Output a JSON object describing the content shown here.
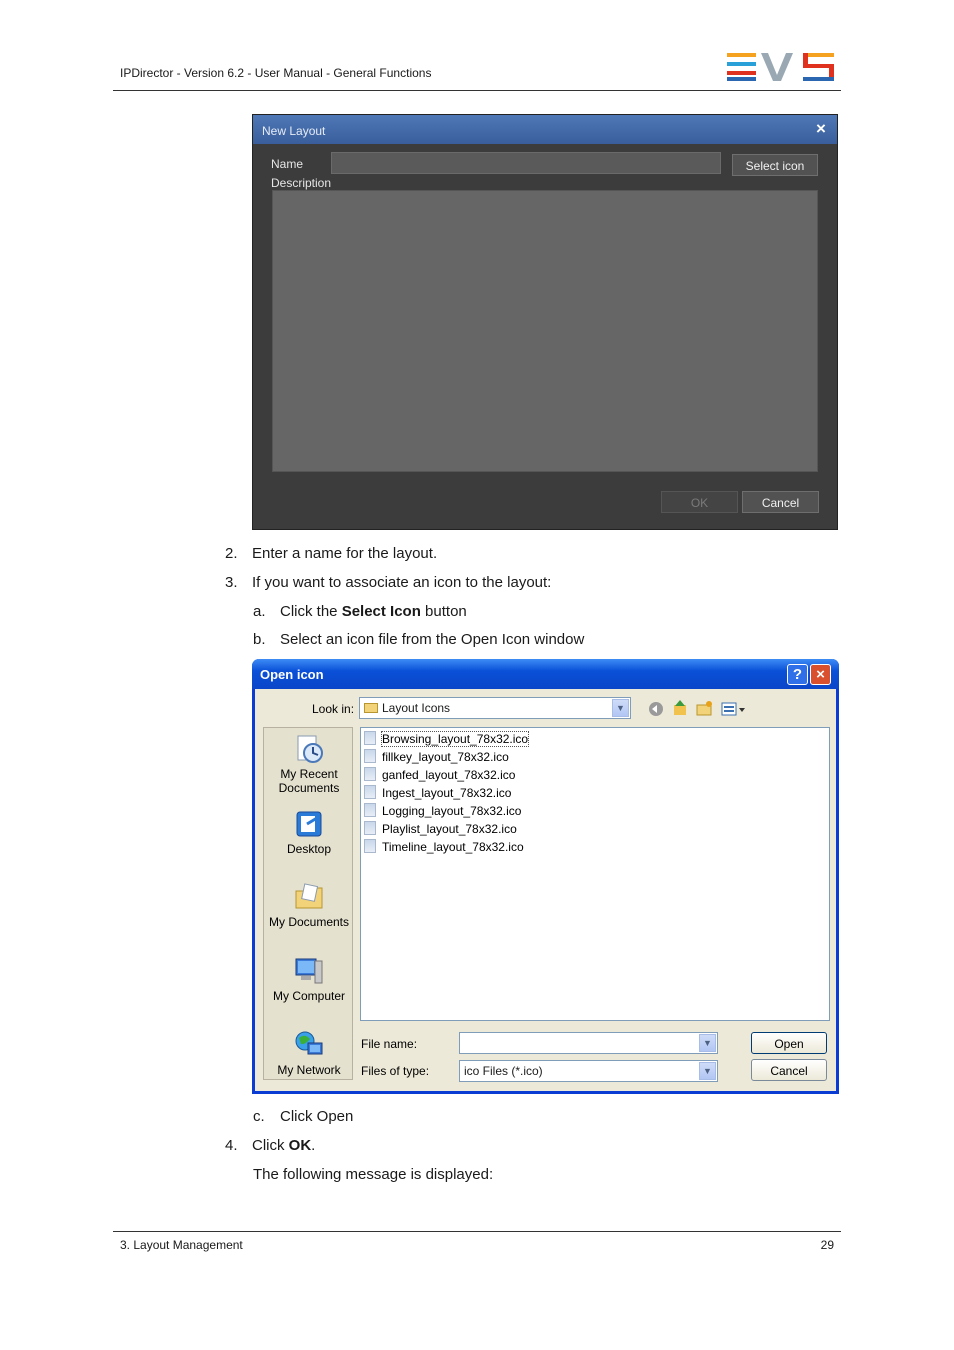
{
  "header": {
    "title": "IPDirector - Version 6.2 - User Manual - General Functions",
    "logo_colors": [
      "#f4a21f",
      "#2aa0d8",
      "#e0301e"
    ]
  },
  "new_layout_dialog": {
    "title": "New Layout",
    "close_icon": "×",
    "name_label": "Name",
    "name_value": "",
    "description_label": "Description",
    "select_icon_button": "Select icon",
    "ok_button": "OK",
    "cancel_button": "Cancel"
  },
  "steps": {
    "s2": {
      "num": "2.",
      "text": "Enter a name for the layout."
    },
    "s3": {
      "num": "3.",
      "text": "If you want to associate an icon to the layout:"
    },
    "sa": {
      "num": "a.",
      "pre": "Click the ",
      "bold": "Select Icon",
      "post": " button"
    },
    "sb": {
      "num": "b.",
      "text": "Select an icon file from the Open Icon window"
    },
    "sc": {
      "num": "c.",
      "text": "Click Open"
    },
    "s4": {
      "num": "4.",
      "pre": "Click ",
      "bold": "OK",
      "post": "."
    },
    "after": "The following message is displayed:"
  },
  "open_icon_dialog": {
    "title": "Open icon",
    "help_icon": "?",
    "close_icon": "×",
    "look_in_label": "Look in:",
    "look_in_value": "Layout Icons",
    "places": [
      "My Recent Documents",
      "Desktop",
      "My Documents",
      "My Computer",
      "My Network"
    ],
    "files": [
      "Browsing_layout_78x32.ico",
      "fillkey_layout_78x32.ico",
      "ganfed_layout_78x32.ico",
      "Ingest_layout_78x32.ico",
      "Logging_layout_78x32.ico",
      "Playlist_layout_78x32.ico",
      "Timeline_layout_78x32.ico"
    ],
    "file_name_label": "File name:",
    "file_name_value": "",
    "file_type_label": "Files of type:",
    "file_type_value": "ico Files (*.ico)",
    "open_button": "Open",
    "cancel_button": "Cancel"
  },
  "footer": {
    "section": "3. Layout Management",
    "page": "29"
  }
}
